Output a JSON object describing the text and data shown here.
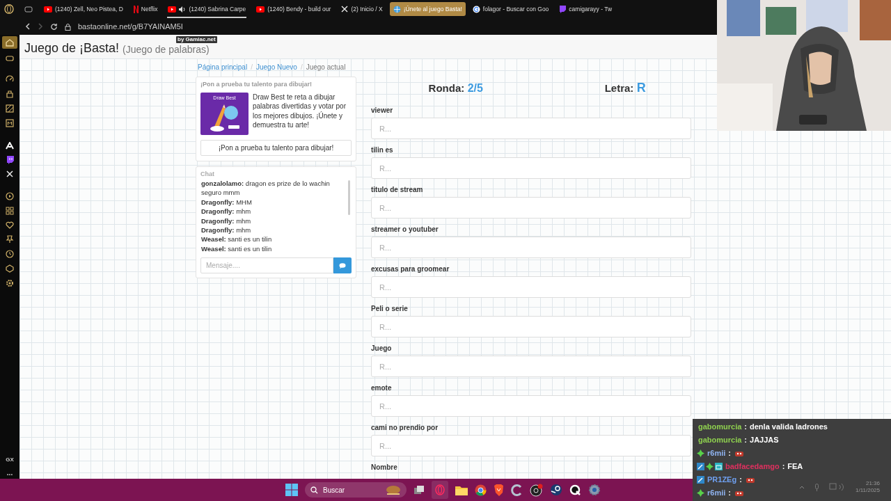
{
  "browser": {
    "tabs": [
      {
        "label": "(1240) Zell, Neo Pistea, D",
        "kind": "youtube",
        "audio": false,
        "selected": false
      },
      {
        "label": "Netflix",
        "kind": "netflix",
        "audio": false,
        "selected": false
      },
      {
        "label": "(1240) Sabrina Carpe",
        "kind": "youtube",
        "audio": true,
        "selected": false
      },
      {
        "label": "(1240) Bendy - build our",
        "kind": "youtube",
        "audio": false,
        "selected": false
      },
      {
        "label": "(2) Inicio / X",
        "kind": "x",
        "audio": false,
        "selected": false
      },
      {
        "label": "¡Únete al juego Basta!",
        "kind": "basta",
        "audio": false,
        "selected": true
      },
      {
        "label": "folagor - Buscar con Goo",
        "kind": "google",
        "audio": false,
        "selected": false
      },
      {
        "label": "camigarayy - Tw",
        "kind": "twitch",
        "audio": false,
        "selected": false
      }
    ],
    "address": "bastaonline.net/g/B7YAINAM5I"
  },
  "sidebar": {
    "footer": "GX",
    "more": "..."
  },
  "page": {
    "title": "Juego de ¡Basta!",
    "subtitle": "(Juego de palabras)",
    "badge": "by Gamiac.net",
    "breadcrumb": [
      {
        "label": "Página principal",
        "link": true
      },
      {
        "separator": "/",
        "label": "Juego Nuevo",
        "link": true
      },
      {
        "separator": "/",
        "label": "Juego actual",
        "link": false
      }
    ],
    "promo": {
      "heading": "¡Pon a prueba tu talento para dibujar!",
      "image_title": "Draw Best",
      "text": "Draw Best te reta a dibujar palabras divertidas y votar por los mejores dibujos. ¡Únete y demuestra tu arte!",
      "button": "¡Pon a prueba tu talento para dibujar!"
    },
    "chat": {
      "title": "Chat",
      "messages": [
        {
          "user": "gonzalolamo:",
          "text": "dragon es prize de lo wachin seguro mmm"
        },
        {
          "user": "Dragonfly:",
          "text": "MHM"
        },
        {
          "user": "Dragonfly:",
          "text": "mhm"
        },
        {
          "user": "Dragonfly:",
          "text": "mhm"
        },
        {
          "user": "Dragonfly:",
          "text": "mhm"
        },
        {
          "user": "Weasel:",
          "text": "santi es un tilin"
        },
        {
          "user": "Weasel:",
          "text": "santi es un tilin"
        }
      ],
      "placeholder": "Mensaje...."
    },
    "round": {
      "label": "Ronda:",
      "value": "2/5"
    },
    "letter": {
      "label": "Letra:",
      "value": "R"
    },
    "fields": [
      {
        "label": "viewer",
        "placeholder": "R..."
      },
      {
        "label": "tilin es",
        "placeholder": "R..."
      },
      {
        "label": "titulo de stream",
        "placeholder": "R..."
      },
      {
        "label": "streamer o youtuber",
        "placeholder": "R..."
      },
      {
        "label": "excusas para groomear",
        "placeholder": "R..."
      },
      {
        "label": "Peli o serie",
        "placeholder": "R..."
      },
      {
        "label": "Juego",
        "placeholder": "R..."
      },
      {
        "label": "emote",
        "placeholder": "R..."
      },
      {
        "label": "cami no prendio por",
        "placeholder": "R..."
      },
      {
        "label": "Nombre"
      }
    ]
  },
  "stream_chat": [
    {
      "user": "gabomurcia",
      "color": "#8fd14f",
      "colon": ":",
      "text": "denla valida ladrones"
    },
    {
      "user": "gabomurcia",
      "color": "#8fd14f",
      "colon": ":",
      "text": "JAJJAS"
    },
    {
      "user": "r6mii",
      "color": "#8fb3f0",
      "badges": [
        {
          "kind": "diamond"
        }
      ],
      "colon": ":",
      "emote": true
    },
    {
      "user": "badfacedamgo",
      "color": "#e0305f",
      "badges": [
        {
          "kind": "artist"
        },
        {
          "kind": "diamond"
        },
        {
          "kind": "gift"
        }
      ],
      "colon": ":",
      "text": "FEA"
    },
    {
      "user": "PR1ZEg",
      "color": "#6fa0f0",
      "badges": [
        {
          "kind": "artist"
        }
      ],
      "colon": ":",
      "emote": true
    },
    {
      "user": "r6mii",
      "color": "#8fb3f0",
      "badges": [
        {
          "kind": "diamond"
        }
      ],
      "colon": ":",
      "emote": true
    }
  ],
  "taskbar": {
    "search": "Buscar",
    "time": "21:36",
    "date": "1/11/2025"
  }
}
